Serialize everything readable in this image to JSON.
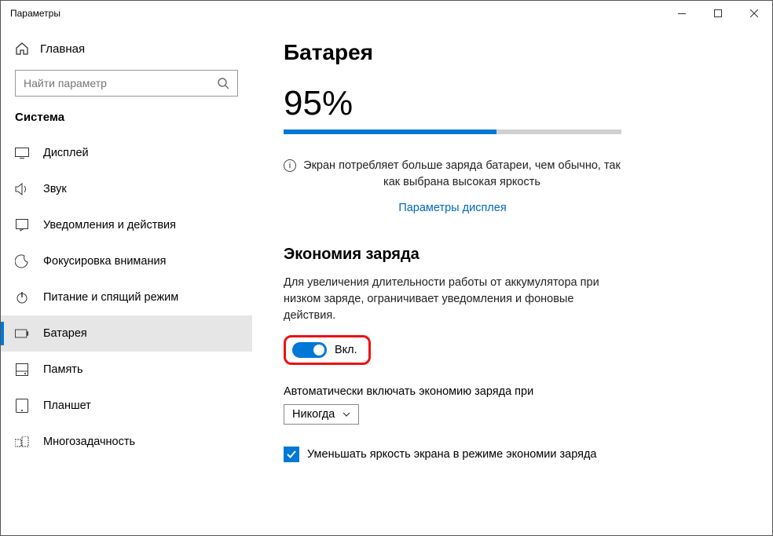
{
  "window": {
    "title": "Параметры"
  },
  "sidebar": {
    "home_label": "Главная",
    "search_placeholder": "Найти параметр",
    "category": "Система",
    "items": [
      {
        "label": "Дисплей"
      },
      {
        "label": "Звук"
      },
      {
        "label": "Уведомления и действия"
      },
      {
        "label": "Фокусировка внимания"
      },
      {
        "label": "Питание и спящий режим"
      },
      {
        "label": "Батарея"
      },
      {
        "label": "Память"
      },
      {
        "label": "Планшет"
      },
      {
        "label": "Многозадачность"
      }
    ]
  },
  "main": {
    "title": "Батарея",
    "percent": "95%",
    "percent_value": 95,
    "info_text": "Экран потребляет больше заряда батареи, чем обычно, так как выбрана высокая яркость",
    "display_link": "Параметры дисплея",
    "saver_title": "Экономия заряда",
    "saver_desc": "Для увеличения длительности работы от аккумулятора при низком заряде, ограничивает уведомления и фоновые действия.",
    "toggle_state": "Вкл.",
    "auto_label": "Автоматически включать экономию заряда при",
    "dropdown_value": "Никогда",
    "checkbox_label": "Уменьшать яркость экрана в режиме экономии заряда",
    "checkbox_checked": true
  }
}
